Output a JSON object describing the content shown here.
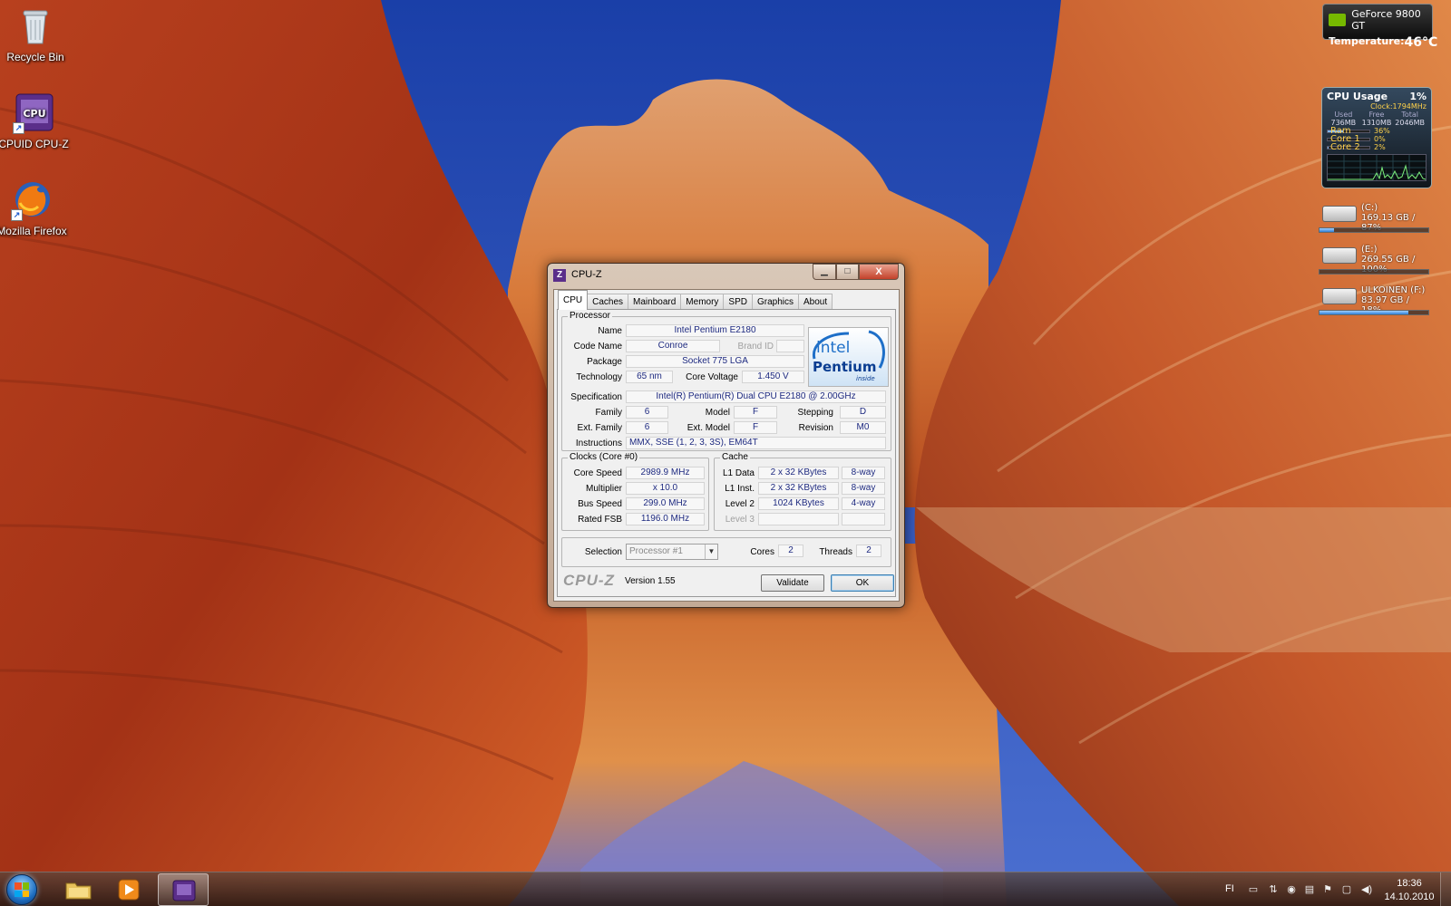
{
  "desktop": {
    "icons": [
      {
        "label": "Recycle Bin",
        "icon": "recycle-bin-icon"
      },
      {
        "label": "CPUID CPU-Z",
        "icon": "cpuz-icon"
      },
      {
        "label": "Mozilla Firefox",
        "icon": "firefox-icon"
      }
    ]
  },
  "gadgets": {
    "gpu": {
      "name": "GeForce 9800 GT",
      "temp_label": "Temperature:",
      "temp_value": "46°C"
    },
    "cpu": {
      "title": "CPU Usage",
      "usage": "1%",
      "clock": "Clock:1794MHz",
      "headers": [
        "Used",
        "Free",
        "Total"
      ],
      "values": [
        "736MB",
        "1310MB",
        "2046MB"
      ],
      "bars": [
        {
          "label": "Ram",
          "pct": "36%",
          "fill": 0.36
        },
        {
          "label": "Core 1",
          "pct": "0%",
          "fill": 0.0
        },
        {
          "label": "Core 2",
          "pct": "2%",
          "fill": 0.02
        }
      ]
    },
    "drives": [
      {
        "name": "(C:)",
        "info": "169.13 GB / 87%",
        "fill": 0.13
      },
      {
        "name": "(E:)",
        "info": "269.55 GB / 100%",
        "fill": 0.0
      },
      {
        "name": "ULKOINEN (F:)",
        "info": "83.97 GB / 18%",
        "fill": 0.82
      }
    ]
  },
  "cpuz": {
    "title": "CPU-Z",
    "app_icon_glyph": "Z",
    "window_buttons": {
      "minimize": "▁",
      "maximize": "□",
      "close": "X"
    },
    "tabs": [
      "CPU",
      "Caches",
      "Mainboard",
      "Memory",
      "SPD",
      "Graphics",
      "About"
    ],
    "active_tab": "CPU",
    "processor": {
      "group_title": "Processor",
      "name_label": "Name",
      "name": "Intel Pentium E2180",
      "codename_label": "Code Name",
      "codename": "Conroe",
      "brandid_label": "Brand ID",
      "brandid": "",
      "package_label": "Package",
      "package": "Socket 775 LGA",
      "technology_label": "Technology",
      "technology": "65 nm",
      "voltage_label": "Core Voltage",
      "voltage": "1.450 V",
      "spec_label": "Specification",
      "spec": "Intel(R) Pentium(R) Dual  CPU  E2180  @ 2.00GHz",
      "family_label": "Family",
      "family": "6",
      "model_label": "Model",
      "model": "F",
      "stepping_label": "Stepping",
      "stepping": "D",
      "extfamily_label": "Ext. Family",
      "extfamily": "6",
      "extmodel_label": "Ext. Model",
      "extmodel": "F",
      "revision_label": "Revision",
      "revision": "M0",
      "instructions_label": "Instructions",
      "instructions": "MMX, SSE (1, 2, 3, 3S), EM64T",
      "logo_brand": "intel",
      "logo_product": "Pentium",
      "logo_inside": "inside"
    },
    "clocks": {
      "group_title": "Clocks (Core #0)",
      "corespeed_label": "Core Speed",
      "corespeed": "2989.9 MHz",
      "multiplier_label": "Multiplier",
      "multiplier": "x 10.0",
      "busspeed_label": "Bus Speed",
      "busspeed": "299.0 MHz",
      "ratedfsb_label": "Rated FSB",
      "ratedfsb": "1196.0 MHz"
    },
    "cache": {
      "group_title": "Cache",
      "l1data_label": "L1 Data",
      "l1data": "2 x 32 KBytes",
      "l1data_way": "8-way",
      "l1inst_label": "L1 Inst.",
      "l1inst": "2 x 32 KBytes",
      "l1inst_way": "8-way",
      "l2_label": "Level 2",
      "l2": "1024 KBytes",
      "l2_way": "4-way",
      "l3_label": "Level 3",
      "l3": "",
      "l3_way": ""
    },
    "selection": {
      "label": "Selection",
      "value": "Processor #1",
      "cores_label": "Cores",
      "cores": "2",
      "threads_label": "Threads",
      "threads": "2"
    },
    "footer": {
      "brand": "CPU-Z",
      "version": "Version 1.55",
      "validate": "Validate",
      "ok": "OK"
    }
  },
  "taskbar": {
    "language": "FI",
    "time": "18:36",
    "date": "14.10.2010",
    "pinned": [
      "windows-explorer-icon",
      "media-player-icon",
      "cpuz-icon"
    ]
  }
}
